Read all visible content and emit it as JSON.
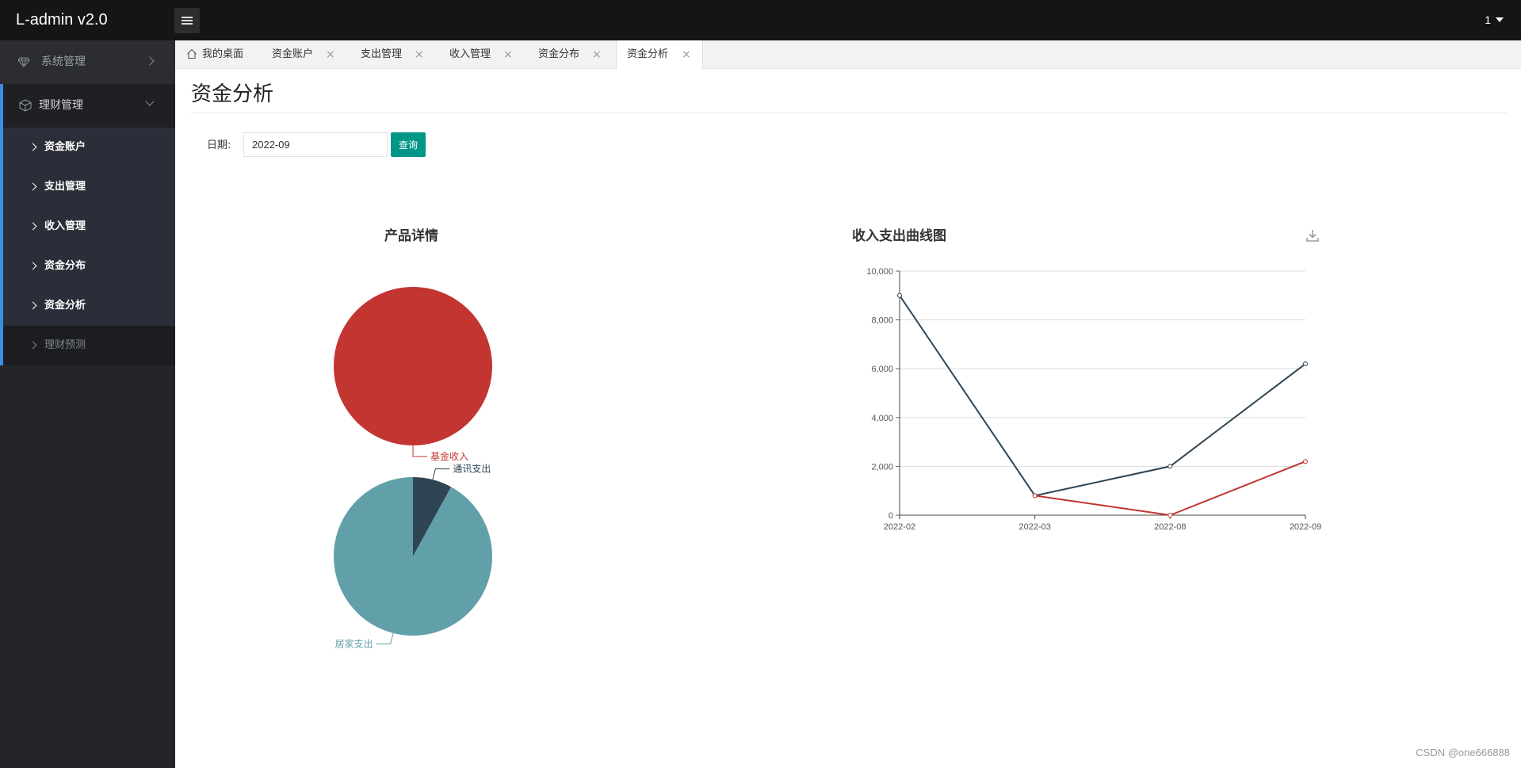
{
  "app": {
    "title": "L-admin v2.0",
    "user": "1"
  },
  "sidebar": {
    "groups": [
      {
        "label": "系统管理",
        "icon": "diamond-icon",
        "expanded": false
      },
      {
        "label": "理财管理",
        "icon": "cube-icon",
        "expanded": true
      }
    ],
    "sub_items": [
      {
        "label": "资金账户"
      },
      {
        "label": "支出管理"
      },
      {
        "label": "收入管理"
      },
      {
        "label": "资金分布"
      },
      {
        "label": "资金分析"
      },
      {
        "label": "理财预测"
      }
    ]
  },
  "tabs": [
    {
      "label": "我的桌面",
      "icon": "home-icon",
      "closable": false
    },
    {
      "label": "资金账户",
      "closable": true
    },
    {
      "label": "支出管理",
      "closable": true
    },
    {
      "label": "收入管理",
      "closable": true
    },
    {
      "label": "资金分布",
      "closable": true
    },
    {
      "label": "资金分析",
      "closable": true,
      "active": true
    }
  ],
  "page": {
    "title": "资金分析",
    "date_label": "日期:",
    "date_value": "2022-09",
    "query_label": "查询"
  },
  "watermark": "CSDN @one666888",
  "colors": {
    "red": "#c23531",
    "dark": "#2f4554",
    "teal": "#61a0a8",
    "accent": "#009688",
    "sidebar_accent": "#3a8ee6"
  },
  "chart_data": [
    {
      "type": "pie",
      "title": "产品详情",
      "pies": [
        {
          "slices": [
            {
              "name": "基金收入",
              "value": 100,
              "color": "#c23531"
            }
          ]
        },
        {
          "slices": [
            {
              "name": "通讯支出",
              "value": 8,
              "color": "#2f4554"
            },
            {
              "name": "居家支出",
              "value": 92,
              "color": "#61a0a8"
            }
          ]
        }
      ]
    },
    {
      "type": "line",
      "title": "收入支出曲线图",
      "categories": [
        "2022-02",
        "2022-03",
        "2022-08",
        "2022-09"
      ],
      "ylim": [
        0,
        10000
      ],
      "yticks": [
        "0",
        "2,000",
        "4,000",
        "6,000",
        "8,000",
        "10,000"
      ],
      "series": [
        {
          "values": [
            9000,
            800,
            2000,
            6200
          ],
          "color": "#2f4554"
        },
        {
          "values": [
            null,
            800,
            0,
            2200
          ],
          "color": "#c23531"
        }
      ],
      "grid": true,
      "toolbox": "download-icon"
    }
  ]
}
